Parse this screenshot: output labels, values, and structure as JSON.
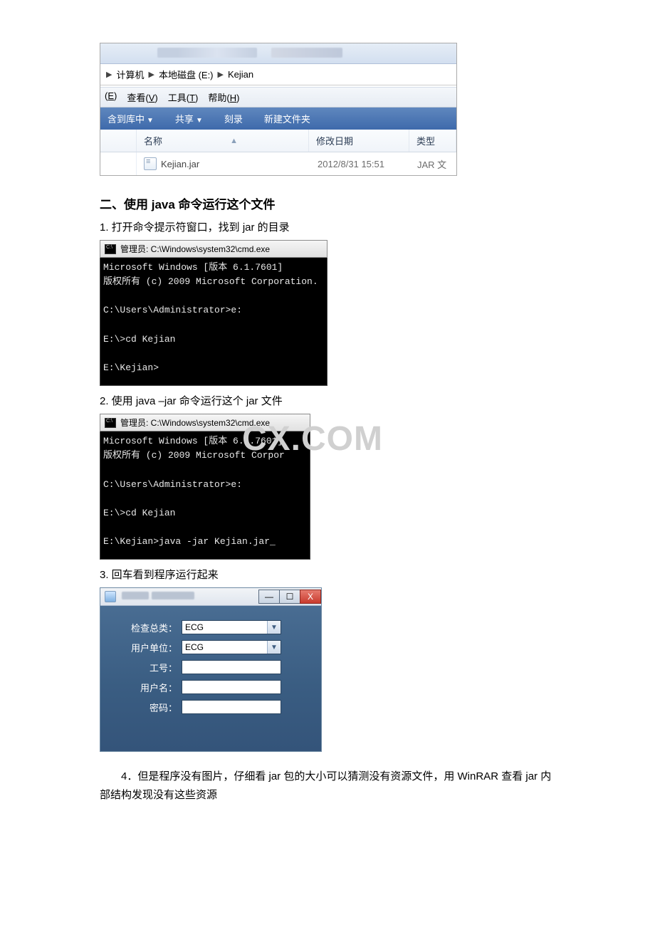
{
  "explorer": {
    "breadcrumb": {
      "seg1": "计算机",
      "seg2": "本地磁盘 (E:)",
      "seg3": "Kejian"
    },
    "menus": {
      "edit_key": "E",
      "view": "查看(",
      "view_key": "V",
      "view_close": ")",
      "tools": "工具(",
      "tools_key": "T",
      "tools_close": ")",
      "help": "帮助(",
      "help_key": "H",
      "help_close": ")"
    },
    "toolbar": {
      "include": "含到库中",
      "share": "共享",
      "burn": "刻录",
      "newfolder": "新建文件夹"
    },
    "columns": {
      "name": "名称",
      "date": "修改日期",
      "type": "类型"
    },
    "rows": [
      {
        "name": "Kejian.jar",
        "date": "2012/8/31 15:51",
        "type": "JAR 文"
      }
    ]
  },
  "section2": {
    "heading": "二、使用 java 命令运行这个文件",
    "step1": "1. 打开命令提示符窗口，找到 jar 的目录",
    "step2": "2. 使用 java –jar 命令运行这个 jar 文件",
    "step3": "3. 回车看到程序运行起来",
    "step4": "4．但是程序没有图片，仔细看 jar 包的大小可以猜测没有资源文件，用 WinRAR 查看 jar 内部结构发现没有这些资源"
  },
  "terminal": {
    "title": "管理员: C:\\Windows\\system32\\cmd.exe",
    "body1": "Microsoft Windows [版本 6.1.7601]\n版权所有 (c) 2009 Microsoft Corporation.\n\nC:\\Users\\Administrator>e:\n\nE:\\>cd Kejian\n\nE:\\Kejian>",
    "body2": "Microsoft Windows [版本 6.1.7601]\n版权所有 (c) 2009 Microsoft Corpor\n\nC:\\Users\\Administrator>e:\n\nE:\\>cd Kejian\n\nE:\\Kejian>java -jar Kejian.jar_"
  },
  "watermark": "CX.COM",
  "login": {
    "labels": {
      "checktype": "检查总类：",
      "userorg": "用户单位：",
      "workid": "工号：",
      "username": "用户名：",
      "password": "密码："
    },
    "values": {
      "checktype": "ECG",
      "userorg": "ECG",
      "workid": "",
      "username": "",
      "password": ""
    },
    "winbtn": {
      "min": "—",
      "max": "☐",
      "close": "X"
    }
  }
}
